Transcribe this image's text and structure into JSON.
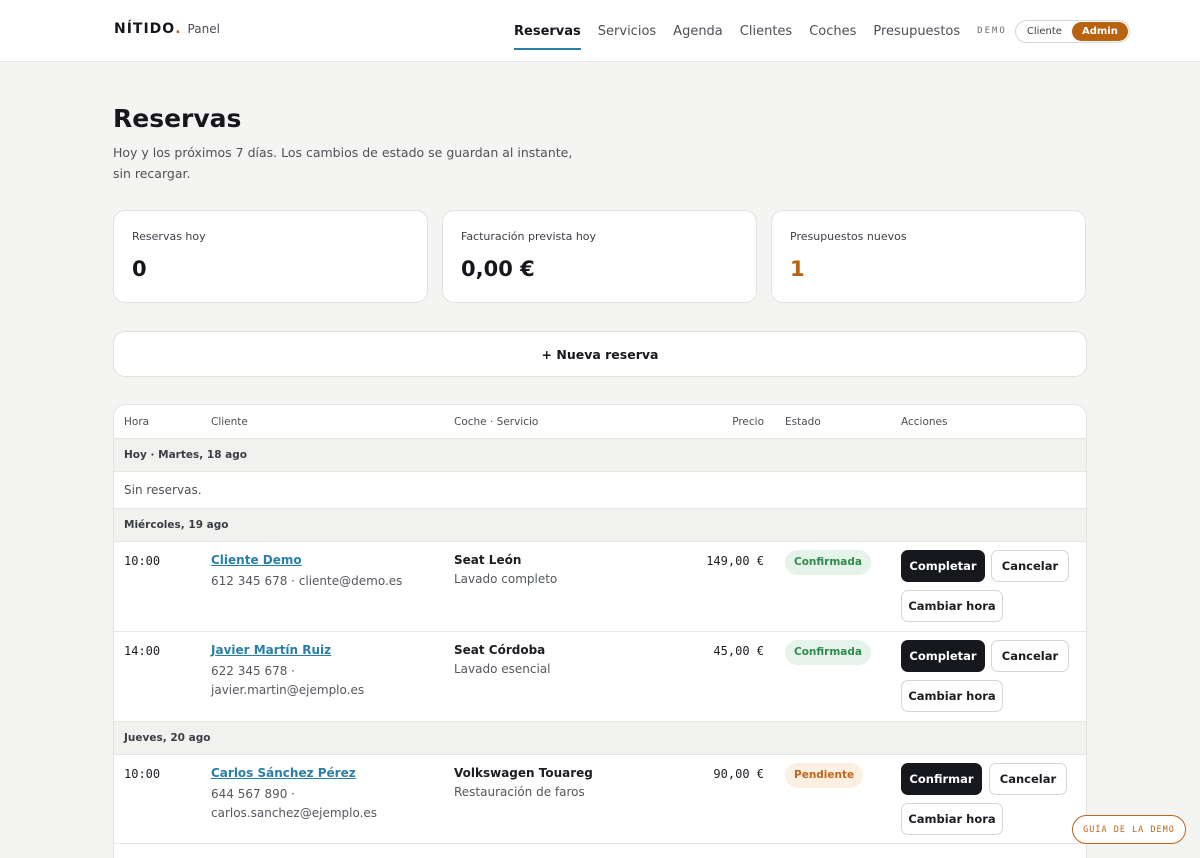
{
  "brand": {
    "logo": "NÍTIDO",
    "dot": ".",
    "sub": "Panel"
  },
  "nav": {
    "items": [
      "Reservas",
      "Servicios",
      "Agenda",
      "Clientes",
      "Coches",
      "Presupuestos"
    ],
    "demo": "DEMO",
    "roles": [
      "Cliente",
      "Admin"
    ]
  },
  "page": {
    "title": "Reservas",
    "subtitle": "Hoy y los próximos 7 días. Los cambios de estado se guardan al instante, sin recargar."
  },
  "stats": [
    {
      "label": "Reservas hoy",
      "value": "0"
    },
    {
      "label": "Facturación prevista hoy",
      "value": "0,00 €"
    },
    {
      "label": "Presupuestos nuevos",
      "value": "1"
    }
  ],
  "new_booking": "+ Nueva reserva",
  "table": {
    "headers": [
      "Hora",
      "Cliente",
      "Coche · Servicio",
      "Precio",
      "Estado",
      "Acciones"
    ],
    "groups": [
      {
        "label": "Hoy · Martes, 18 ago",
        "empty": "Sin reservas."
      },
      {
        "label": "Miércoles, 19 ago"
      },
      {
        "label": "Jueves, 20 ago"
      }
    ],
    "rows": [
      {
        "time": "10:00",
        "name": "Cliente Demo",
        "contact": "612 345 678 · cliente@demo.es",
        "car": "Seat León",
        "service": "Lavado completo",
        "price": "149,00 €",
        "status": "Confirmada",
        "primary": "Completar",
        "cancel": "Cancelar",
        "reschedule": "Cambiar hora"
      },
      {
        "time": "14:00",
        "name": "Javier Martín Ruiz",
        "contact": "622 345 678 · javier.martin@ejemplo.es",
        "car": "Seat Córdoba",
        "service": "Lavado esencial",
        "price": "45,00 €",
        "status": "Confirmada",
        "primary": "Completar",
        "cancel": "Cancelar",
        "reschedule": "Cambiar hora"
      },
      {
        "time": "10:00",
        "name": "Carlos Sánchez Pérez",
        "contact": "644 567 890 · carlos.sanchez@ejemplo.es",
        "car": "Volkswagen Touareg",
        "service": "Restauración de faros",
        "price": "90,00 €",
        "status": "Pendiente",
        "primary": "Confirmar",
        "cancel": "Cancelar",
        "reschedule": "Cambiar hora"
      }
    ]
  },
  "guide": "GUÍA DE LA DEMO",
  "colors": {
    "accent": "#b9620f",
    "link": "#2a7fa8",
    "dark": "#16181d"
  }
}
